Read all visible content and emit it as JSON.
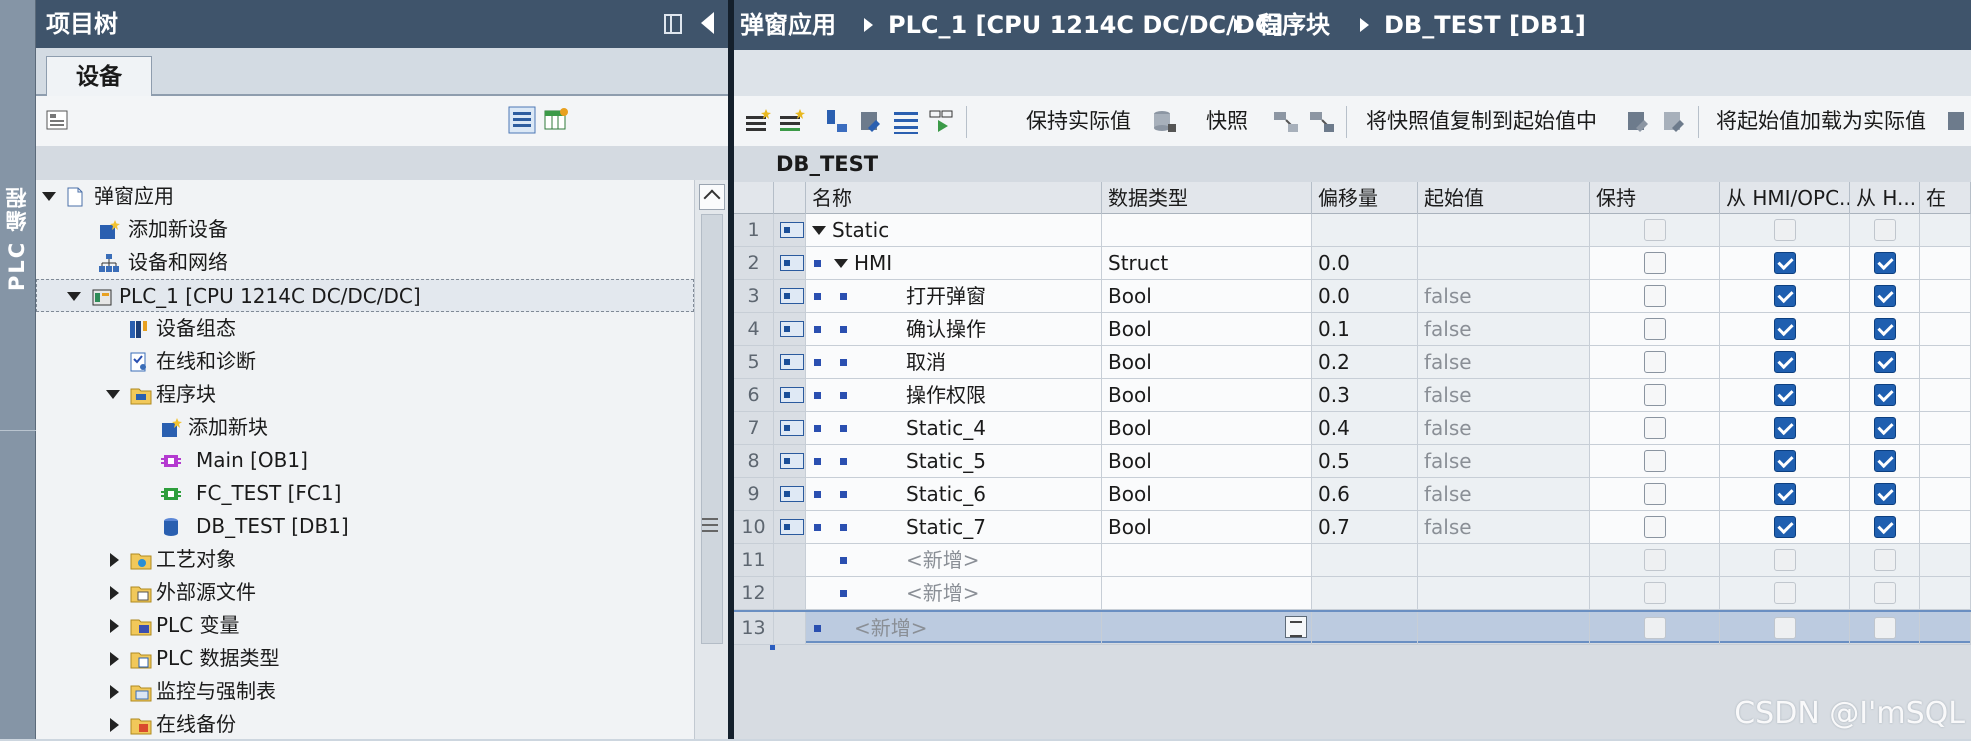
{
  "sidebar_vertical": {
    "label": "PLC 编程"
  },
  "project_tree": {
    "title": "项目树",
    "tab": "设备",
    "items": [
      {
        "label": "弹窗应用",
        "icon": "document-icon",
        "expanded": true
      },
      {
        "label": "添加新设备",
        "icon": "add-device-icon"
      },
      {
        "label": "设备和网络",
        "icon": "network-icon"
      },
      {
        "label": "PLC_1 [CPU 1214C DC/DC/DC]",
        "icon": "plc-icon",
        "expanded": true,
        "selected": true
      },
      {
        "label": "设备组态",
        "icon": "device-config-icon"
      },
      {
        "label": "在线和诊断",
        "icon": "diagnostics-icon"
      },
      {
        "label": "程序块",
        "icon": "program-blocks-folder-icon",
        "expanded": true
      },
      {
        "label": "添加新块",
        "icon": "add-block-icon"
      },
      {
        "label": "Main [OB1]",
        "icon": "ob-block-icon"
      },
      {
        "label": "FC_TEST [FC1]",
        "icon": "fc-block-icon"
      },
      {
        "label": "DB_TEST [DB1]",
        "icon": "db-block-icon"
      },
      {
        "label": "工艺对象",
        "icon": "technology-objects-icon"
      },
      {
        "label": "外部源文件",
        "icon": "external-sources-icon"
      },
      {
        "label": "PLC 变量",
        "icon": "plc-tags-icon"
      },
      {
        "label": "PLC 数据类型",
        "icon": "plc-datatypes-icon"
      },
      {
        "label": "监控与强制表",
        "icon": "watch-table-icon"
      },
      {
        "label": "在线备份",
        "icon": "online-backup-icon"
      }
    ]
  },
  "breadcrumb": [
    "弹窗应用",
    "PLC_1 [CPU 1214C DC/DC/DC]",
    "程序块",
    "DB_TEST [DB1]"
  ],
  "toolbar": {
    "keep_actual": "保持实际值",
    "snapshot": "快照",
    "copy_snapshot": "将快照值复制到起始值中",
    "load_start": "将起始值加载为实际值"
  },
  "db_title": "DB_TEST",
  "table": {
    "headers": {
      "name": "名称",
      "type": "数据类型",
      "offset": "偏移量",
      "start": "起始值",
      "keep": "保持",
      "hmi": "从 HMI/OPC..",
      "hmi2": "从 H...",
      "in": "在"
    },
    "rows": [
      {
        "num": "1",
        "name": "Static",
        "type": "",
        "offset": "",
        "start": "",
        "keep": false,
        "hmi": false,
        "hmi2": false,
        "level": 0,
        "expander": true,
        "dim": true
      },
      {
        "num": "2",
        "name": "HMI",
        "type": "Struct",
        "offset": "0.0",
        "start": "",
        "keep": false,
        "hmi": true,
        "hmi2": true,
        "level": 1,
        "expander": true
      },
      {
        "num": "3",
        "name": "打开弹窗",
        "type": "Bool",
        "offset": "0.0",
        "start": "false",
        "keep": false,
        "hmi": true,
        "hmi2": true,
        "level": 2
      },
      {
        "num": "4",
        "name": "确认操作",
        "type": "Bool",
        "offset": "0.1",
        "start": "false",
        "keep": false,
        "hmi": true,
        "hmi2": true,
        "level": 2
      },
      {
        "num": "5",
        "name": "取消",
        "type": "Bool",
        "offset": "0.2",
        "start": "false",
        "keep": false,
        "hmi": true,
        "hmi2": true,
        "level": 2
      },
      {
        "num": "6",
        "name": "操作权限",
        "type": "Bool",
        "offset": "0.3",
        "start": "false",
        "keep": false,
        "hmi": true,
        "hmi2": true,
        "level": 2
      },
      {
        "num": "7",
        "name": "Static_4",
        "type": "Bool",
        "offset": "0.4",
        "start": "false",
        "keep": false,
        "hmi": true,
        "hmi2": true,
        "level": 2
      },
      {
        "num": "8",
        "name": "Static_5",
        "type": "Bool",
        "offset": "0.5",
        "start": "false",
        "keep": false,
        "hmi": true,
        "hmi2": true,
        "level": 2
      },
      {
        "num": "9",
        "name": "Static_6",
        "type": "Bool",
        "offset": "0.6",
        "start": "false",
        "keep": false,
        "hmi": true,
        "hmi2": true,
        "level": 2
      },
      {
        "num": "10",
        "name": "Static_7",
        "type": "Bool",
        "offset": "0.7",
        "start": "false",
        "keep": false,
        "hmi": true,
        "hmi2": true,
        "level": 2
      },
      {
        "num": "11",
        "name": "<新增>",
        "type": "",
        "offset": "",
        "start": "",
        "keep": false,
        "hmi": false,
        "hmi2": false,
        "level": 2,
        "placeholder": true,
        "dim": true
      },
      {
        "num": "12",
        "name": "<新增>",
        "type": "",
        "offset": "",
        "start": "",
        "keep": false,
        "hmi": false,
        "hmi2": false,
        "level": 2,
        "placeholder": true,
        "dim": true
      },
      {
        "num": "13",
        "name": "<新增>",
        "type": "",
        "offset": "",
        "start": "",
        "keep": false,
        "hmi": false,
        "hmi2": false,
        "level": 1,
        "placeholder": true,
        "dim": true,
        "selected": true
      }
    ]
  },
  "watermark": "CSDN @I'mSQL",
  "colors": {
    "title_bar": "#3f546b",
    "accent": "#1f5fb0",
    "selected_row": "#bccbe0"
  }
}
